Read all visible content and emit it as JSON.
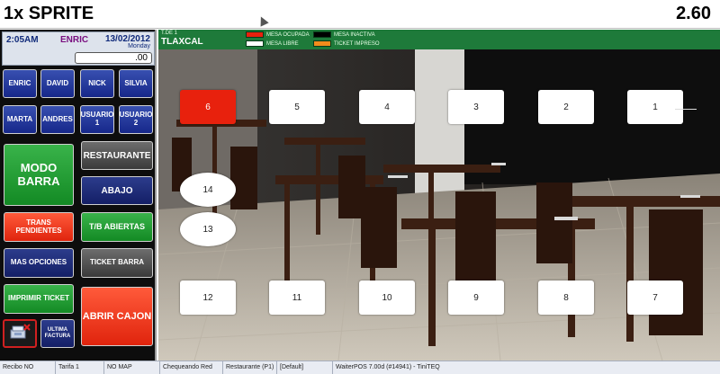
{
  "header": {
    "item": "1x SPRITE",
    "total": "2.60"
  },
  "info": {
    "time": "2:05AM",
    "user": "ENRIC",
    "date": "13/02/2012",
    "day": "Monday",
    "amount": ".00"
  },
  "waiters": [
    "ENRIC",
    "DAVID",
    "NICK",
    "SILVIA",
    "MARTA",
    "ANDRES",
    "USUARIO 1",
    "USUARIO 2"
  ],
  "buttons": {
    "modo_barra": "MODO BARRA",
    "restaurante": "RESTAURANTE",
    "abajo": "ABAJO",
    "trans_pendientes": "TRANS PENDIENTES",
    "tb_abiertas": "T/B ABIERTAS",
    "mas_opciones": "MAS OPCIONES",
    "ticket_barra": "TICKET BARRA",
    "imprimir_ticket": "IMPRIMIR TICKET",
    "abrir_cajon": "ABRIR CAJON",
    "ultima_factura": "ULTIMA FACTURA"
  },
  "zone": {
    "small": "T.DE 1",
    "name": "TLAXCAL"
  },
  "legend": {
    "ocupada": "MESA OCUPADA",
    "inactiva": "MESA INACTIVA",
    "libre": "MESA LIBRE",
    "impreso": "TICKET IMPRESO"
  },
  "colors": {
    "ocupada": "#e8210d",
    "inactiva": "#000000",
    "libre": "#ffffff",
    "impreso": "#f28c1c"
  },
  "tables": [
    {
      "label": "6",
      "status": "occupied"
    },
    {
      "label": "5",
      "status": "free"
    },
    {
      "label": "4",
      "status": "free"
    },
    {
      "label": "3",
      "status": "free"
    },
    {
      "label": "2",
      "status": "free"
    },
    {
      "label": "1",
      "status": "free"
    },
    {
      "label": "14",
      "status": "free"
    },
    {
      "label": "13",
      "status": "free"
    },
    {
      "label": "12",
      "status": "free"
    },
    {
      "label": "11",
      "status": "free"
    },
    {
      "label": "10",
      "status": "free"
    },
    {
      "label": "9",
      "status": "free"
    },
    {
      "label": "8",
      "status": "free"
    },
    {
      "label": "7",
      "status": "free"
    }
  ],
  "status_bar": [
    "Recibo NO",
    "Tarifa 1",
    "NO MAP",
    "Chequeando Red",
    "Restaurante (P1)",
    "[Default]",
    "WaiterPOS 7.00d (#14941) - TiniTEQ"
  ]
}
